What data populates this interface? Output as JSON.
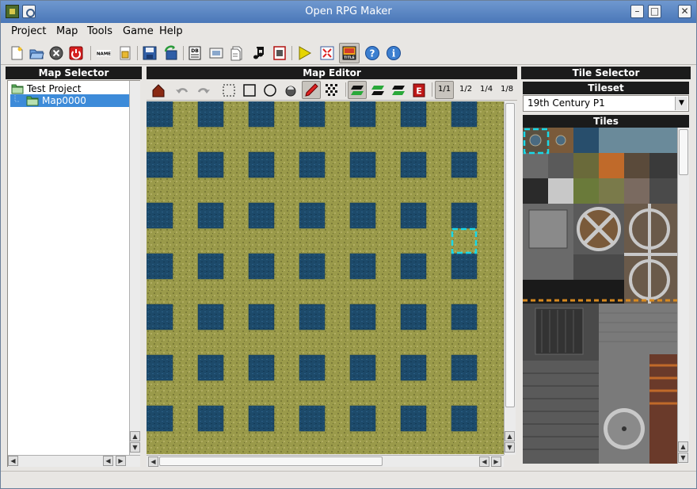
{
  "window": {
    "title": "Open RPG Maker"
  },
  "menu": [
    "Project",
    "Map",
    "Tools",
    "Game",
    "Help"
  ],
  "toolbar_icons": [
    "new-project-icon",
    "open-project-icon",
    "close-project-icon",
    "quit-icon",
    "name-icon",
    "script-icon",
    "save-icon",
    "revert-icon",
    "database-icon",
    "material-icon",
    "scripts-editor-icon",
    "music-icon",
    "import-icon",
    "play-test-icon",
    "fullscreen-icon",
    "title-icon",
    "help-icon",
    "about-icon"
  ],
  "toolbar_labels": {
    "name": "NAME",
    "db": "DB",
    "title": "TITLE"
  },
  "map_selector": {
    "title": "Map Selector",
    "tree": [
      {
        "label": "Test Project",
        "level": 0
      },
      {
        "label": "Map0000",
        "level": 1,
        "selected": true
      }
    ]
  },
  "map_editor": {
    "title": "Map Editor",
    "tools": [
      "layer-icon",
      "undo-icon",
      "redo-icon",
      "select-icon",
      "rectangle-icon",
      "circle-icon",
      "fill-icon",
      "pencil-icon",
      "random-icon"
    ],
    "layers": [
      "lower-layer-icon",
      "upper-layer-icon",
      "event-layer-icon",
      "event-icon"
    ],
    "zoom": [
      "1/1",
      "1/2",
      "1/4",
      "1/8"
    ]
  },
  "tile_selector": {
    "title": "Tile Selector",
    "tileset_label": "Tileset",
    "tileset_value": "19th Century P1",
    "tiles_label": "Tiles"
  },
  "colors": {
    "grass": "#9a9a4a",
    "water": "#1c4a6b",
    "cursor": "#18d8e8",
    "panel_title": "#1b1b1b",
    "selection": "#3d8bd9"
  }
}
